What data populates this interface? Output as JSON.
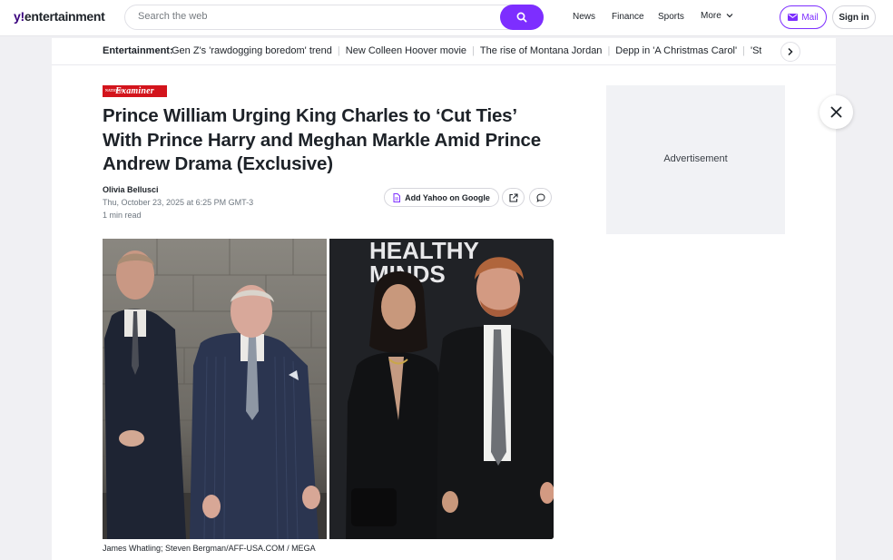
{
  "header": {
    "logo_prefix": "y!",
    "logo_text": "entertainment",
    "search_placeholder": "Search the web",
    "nav": [
      "News",
      "Finance",
      "Sports",
      "More"
    ],
    "mail_label": "Mail",
    "signin_label": "Sign in",
    "accent_color": "#7d2eff"
  },
  "trending": {
    "label": "Entertainment:",
    "items": [
      "Gen Z's 'rawdogging boredom' trend",
      "New Colleen Hoover movie",
      "The rise of Montana Jordan",
      "Depp in 'A Christmas Carol'",
      "'Strange"
    ]
  },
  "article": {
    "publisher_small": "NATIONAL",
    "publisher": "Examiner",
    "headline": "Prince William Urging King Charles to ‘Cut Ties’ With Prince Harry and Meghan Markle Amid Prince Andrew Drama (Exclusive)",
    "author": "Olivia Bellusci",
    "date": "Thu, October 23, 2025 at 6:25 PM GMT-3",
    "read_time": "1 min read",
    "add_google_label": "Add Yahoo on Google",
    "photo_backdrop_text": [
      "HEALTHY",
      "MINDS"
    ],
    "caption": "James Whatling; Steven Bergman/AFF-USA.COM / MEGA"
  },
  "sidebar": {
    "ad_label": "Advertisement"
  }
}
